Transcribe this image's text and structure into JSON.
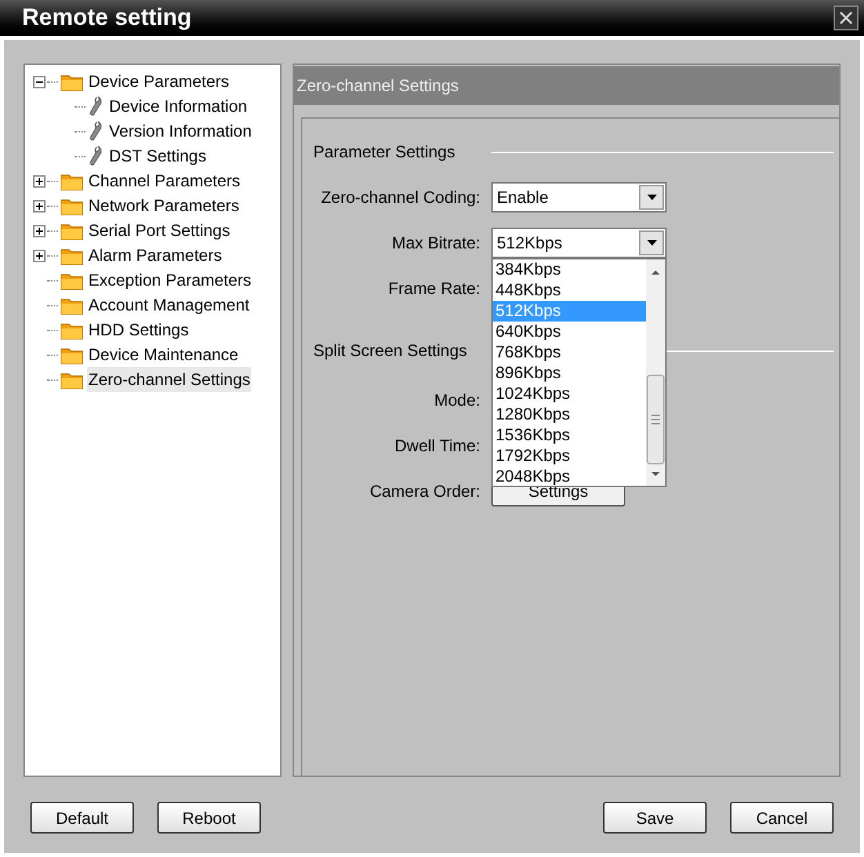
{
  "window": {
    "title": "Remote setting"
  },
  "tree": [
    {
      "label": "Device Parameters",
      "kind": "folder",
      "expanded": true,
      "selected": false,
      "children": [
        {
          "label": "Device Information",
          "kind": "setting",
          "selected": false
        },
        {
          "label": "Version Information",
          "kind": "setting",
          "selected": false
        },
        {
          "label": "DST Settings",
          "kind": "setting",
          "selected": false
        }
      ]
    },
    {
      "label": "Channel Parameters",
      "kind": "folder",
      "expanded": false,
      "selected": false
    },
    {
      "label": "Network Parameters",
      "kind": "folder",
      "expanded": false,
      "selected": false
    },
    {
      "label": "Serial Port Settings",
      "kind": "folder",
      "expanded": false,
      "selected": false
    },
    {
      "label": "Alarm Parameters",
      "kind": "folder",
      "expanded": false,
      "selected": false
    },
    {
      "label": "Exception Parameters",
      "kind": "folder",
      "selected": false
    },
    {
      "label": "Account Management",
      "kind": "folder",
      "selected": false
    },
    {
      "label": "HDD Settings",
      "kind": "folder",
      "selected": false
    },
    {
      "label": "Device Maintenance",
      "kind": "folder",
      "selected": false
    },
    {
      "label": "Zero-channel Settings",
      "kind": "folder",
      "selected": true
    }
  ],
  "panel": {
    "header": "Zero-channel Settings",
    "sections": [
      {
        "title": "Parameter Settings",
        "fields": [
          {
            "label": "Zero-channel Coding:",
            "kind": "select",
            "value": "Enable"
          },
          {
            "label": "Max Bitrate:",
            "kind": "select",
            "value": "512Kbps",
            "options": [
              {
                "label": "384Kbps",
                "selected": false
              },
              {
                "label": "448Kbps",
                "selected": false
              },
              {
                "label": "512Kbps",
                "selected": true
              },
              {
                "label": "640Kbps",
                "selected": false
              },
              {
                "label": "768Kbps",
                "selected": false
              },
              {
                "label": "896Kbps",
                "selected": false
              },
              {
                "label": "1024Kbps",
                "selected": false
              },
              {
                "label": "1280Kbps",
                "selected": false
              },
              {
                "label": "1536Kbps",
                "selected": false
              },
              {
                "label": "1792Kbps",
                "selected": false
              },
              {
                "label": "2048Kbps",
                "selected": false
              }
            ]
          },
          {
            "label": "Frame Rate:"
          }
        ]
      },
      {
        "title": "Split Screen Settings",
        "fields": [
          {
            "label": "Mode:"
          },
          {
            "label": "Dwell Time:"
          },
          {
            "label": "Camera Order:",
            "kind": "button",
            "value": "Settings"
          }
        ]
      }
    ]
  },
  "left_buttons": [
    "Default",
    "Reboot"
  ],
  "right_buttons": [
    "Save",
    "Cancel"
  ]
}
